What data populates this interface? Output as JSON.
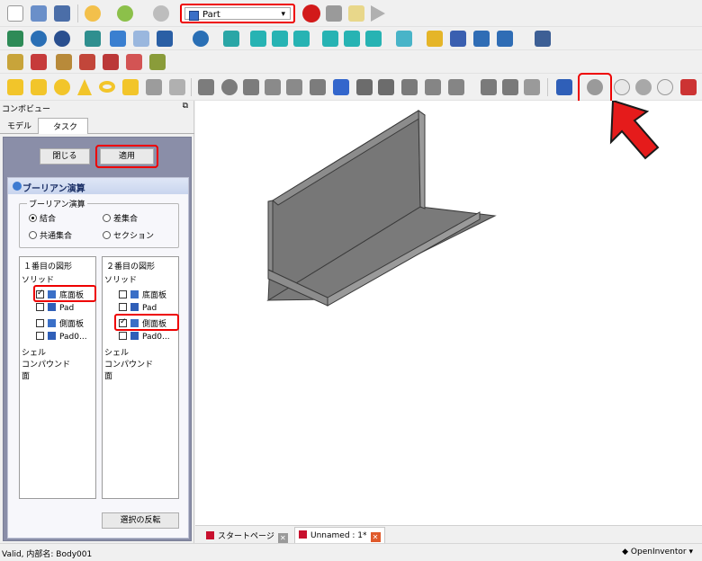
{
  "workbench": {
    "selected": "Part"
  },
  "left_panel": {
    "title": "コンボビュー",
    "tabs": [
      {
        "label": "モデル"
      },
      {
        "label": "タスク"
      }
    ],
    "buttons": {
      "close": "閉じる",
      "apply": "適用",
      "invert": "選択の反転"
    },
    "boolean_panel_title": "ブーリアン演算",
    "group_title": "ブーリアン演算",
    "options": [
      {
        "label": "結合",
        "checked": true
      },
      {
        "label": "差集合",
        "checked": false
      },
      {
        "label": "共通集合",
        "checked": false
      },
      {
        "label": "セクション",
        "checked": false
      }
    ],
    "first_shape": {
      "title": "１番目の図形",
      "solid_label": "ソリッド",
      "items": [
        {
          "label": "底面板",
          "checked": true
        },
        {
          "label": "Pad",
          "checked": false
        },
        {
          "label": "側面板",
          "checked": false
        },
        {
          "label": "Pad0...",
          "checked": false
        }
      ],
      "shell_label": "シェル",
      "compound_label": "コンパウンド",
      "face_label": "面"
    },
    "second_shape": {
      "title": "２番目の図形",
      "solid_label": "ソリッド",
      "items": [
        {
          "label": "底面板",
          "checked": false
        },
        {
          "label": "Pad",
          "checked": false
        },
        {
          "label": "側面板",
          "checked": true
        },
        {
          "label": "Pad0...",
          "checked": false
        }
      ],
      "shell_label": "シェル",
      "compound_label": "コンパウンド",
      "face_label": "面"
    }
  },
  "doc_tabs": [
    {
      "label": "スタートページ"
    },
    {
      "label": "Unnamed : 1*"
    }
  ],
  "status": {
    "message": "Valid, 内部名: Body001",
    "navigation": "OpenInventor"
  },
  "colors": {
    "highlight": "#e00000",
    "model_face": "#7a7a7a",
    "task_bg": "#8a8ea8"
  }
}
